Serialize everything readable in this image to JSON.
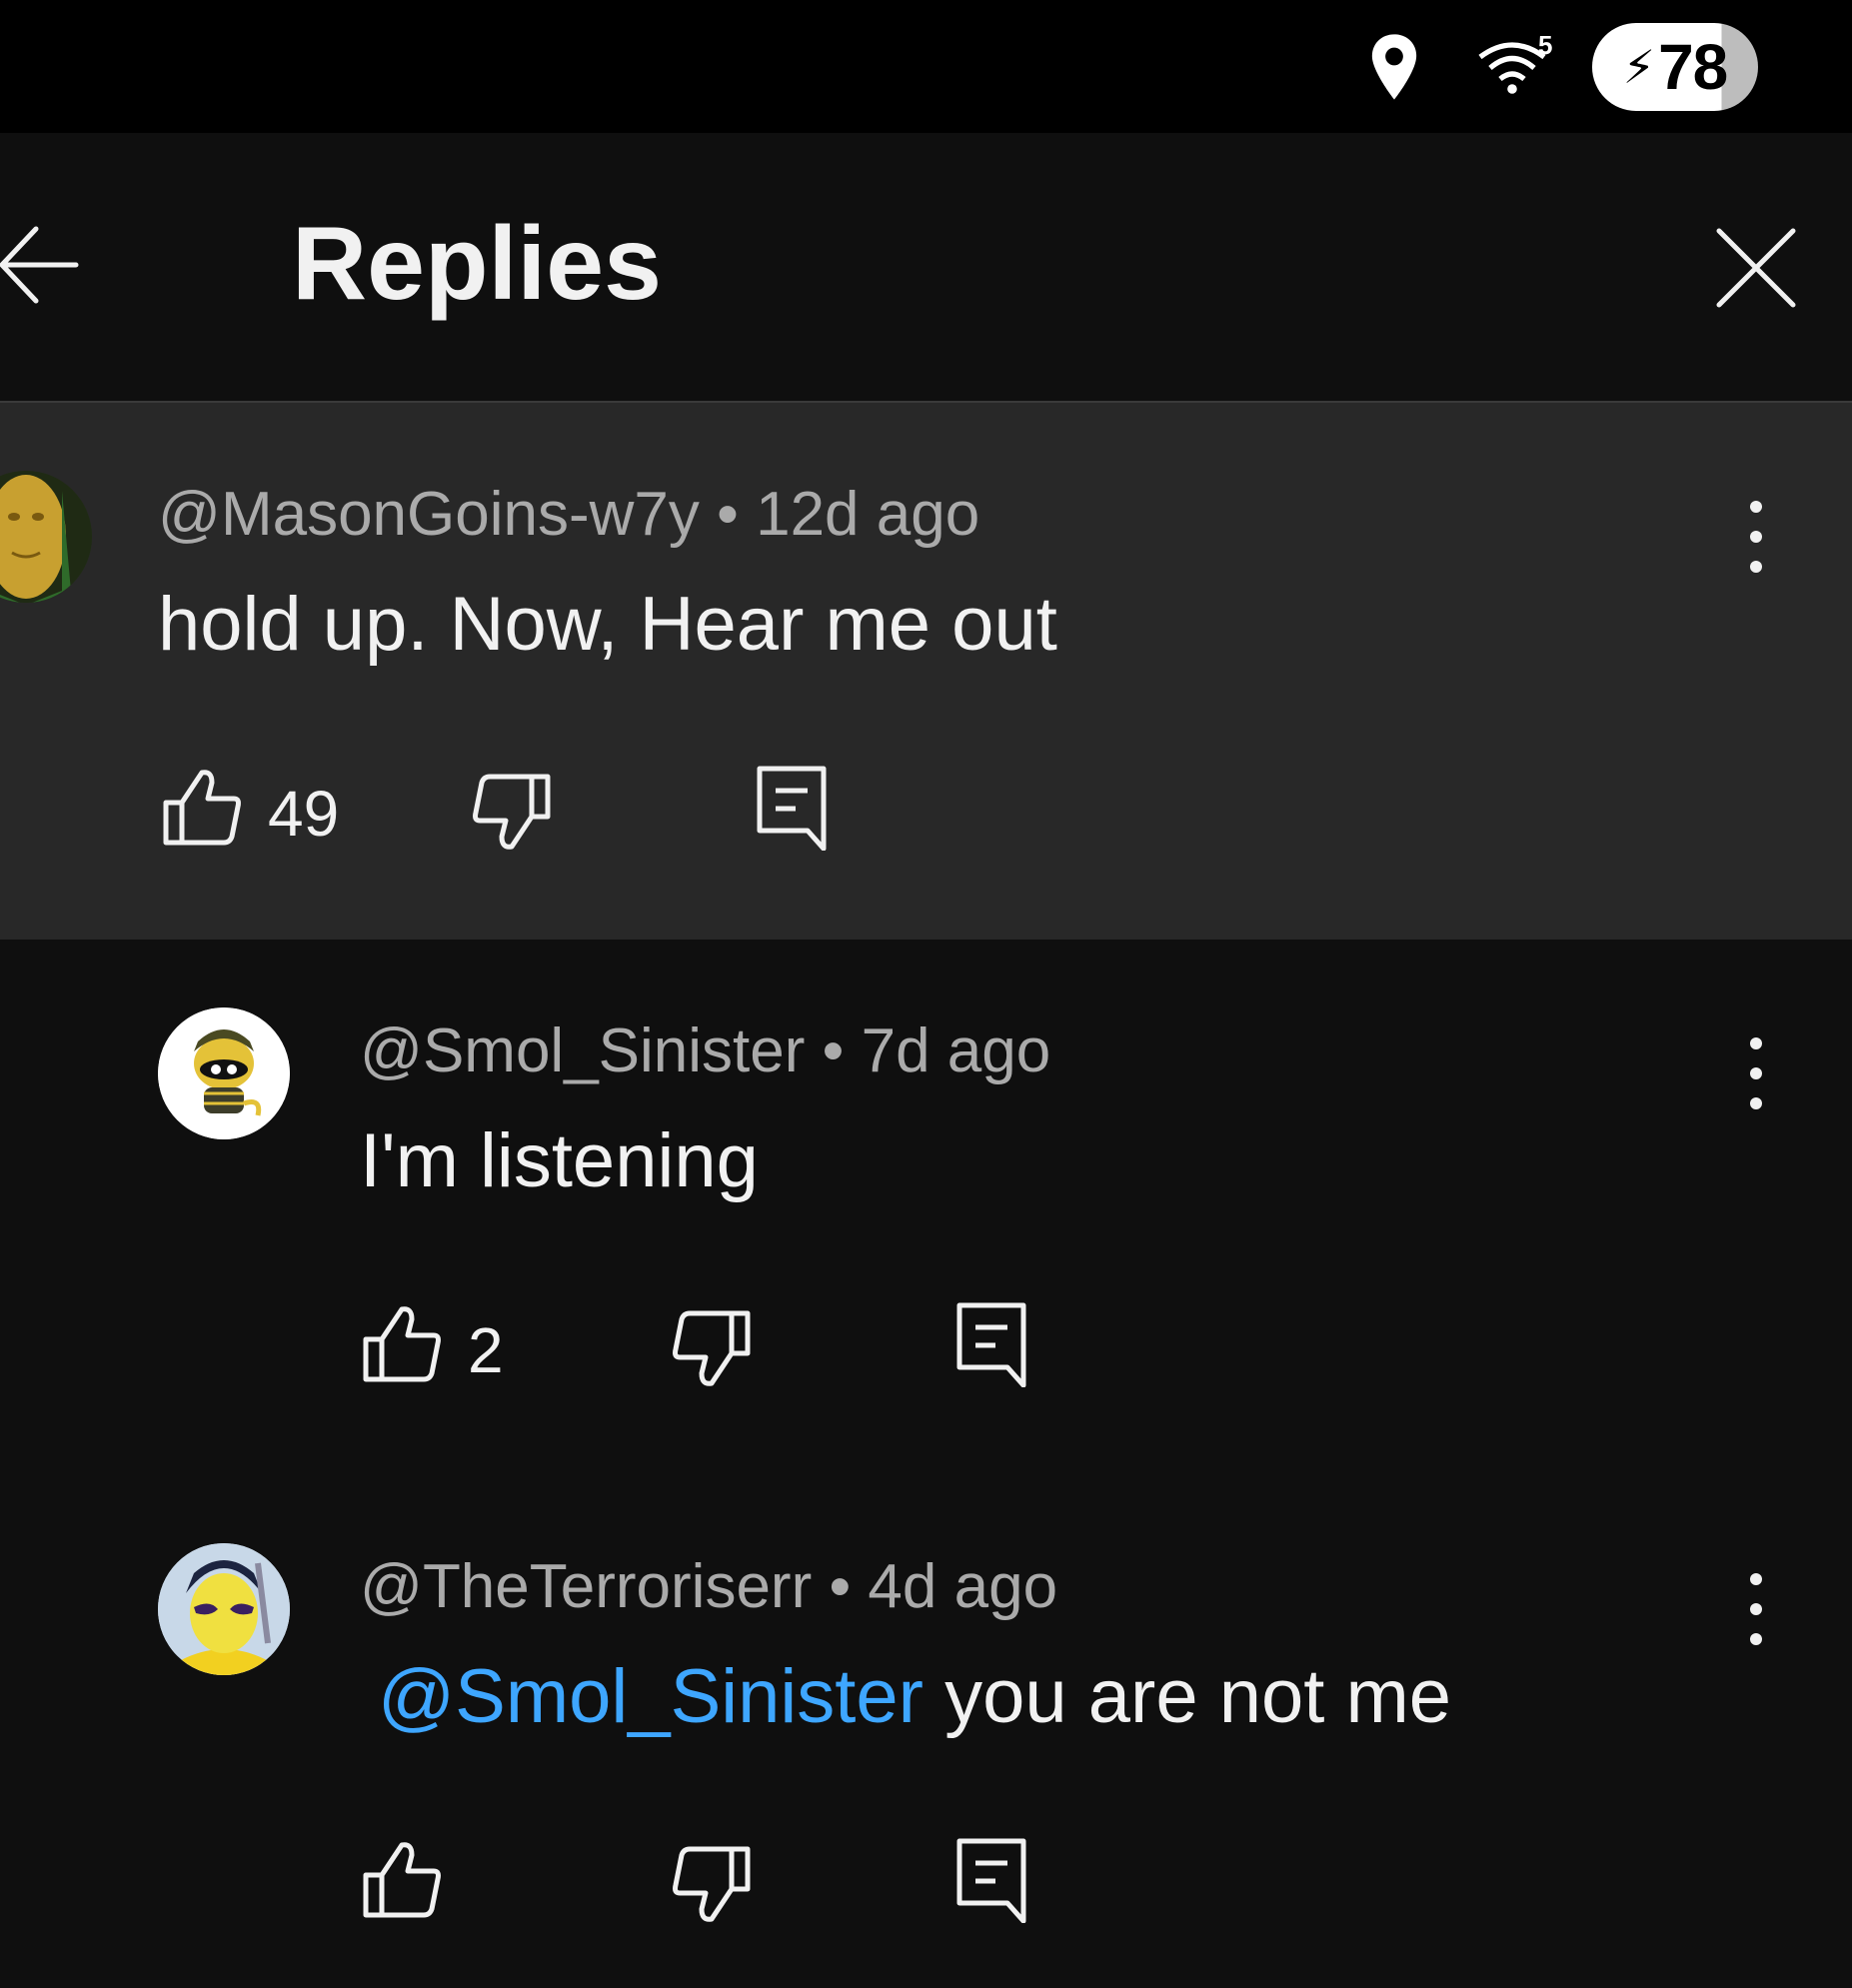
{
  "status_bar": {
    "wifi_badge": "5",
    "battery_level": "78"
  },
  "header": {
    "title": "Replies"
  },
  "comments": [
    {
      "handle": "@MasonGoins-w7y",
      "separator": "•",
      "time": "12d ago",
      "text": "hold up. Now, Hear me out",
      "likes": "49"
    },
    {
      "handle": "@Smol_Sinister",
      "separator": "•",
      "time": "7d ago",
      "text": "I'm listening",
      "likes": "2"
    },
    {
      "handle": "@TheTerroriserr",
      "separator": "•",
      "time": "4d ago",
      "mention": "@Smol_Sinister",
      "text": " you are not me",
      "likes": ""
    }
  ],
  "colors": {
    "background": "#0f0f0f",
    "highlight": "#282828",
    "mention": "#3ea6ff",
    "meta_text": "#aaaaaa"
  }
}
